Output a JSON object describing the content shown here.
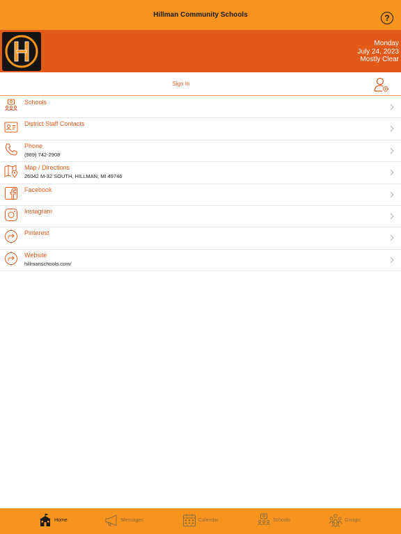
{
  "header": {
    "title": "Hillman Community Schools",
    "help_icon": "help-icon"
  },
  "banner": {
    "day": "Monday",
    "date": "July 24, 2023",
    "weather": "Mostly Clear",
    "logo_letter": "H"
  },
  "signin": {
    "label": "Sign In",
    "icon": "user-settings-icon"
  },
  "list": [
    {
      "label": "Schools",
      "sub": "",
      "icon": "schools-icon"
    },
    {
      "label": "District Staff Contacts",
      "sub": "",
      "icon": "contact-card-icon"
    },
    {
      "label": "Phone",
      "sub": "(989) 742-2908",
      "icon": "phone-icon"
    },
    {
      "label": "Map / Directions",
      "sub": "26042 M-32 SOUTH, HILLMAN, MI 49746",
      "icon": "map-icon"
    },
    {
      "label": "Facebook",
      "sub": "",
      "icon": "facebook-icon"
    },
    {
      "label": "Instagram",
      "sub": "",
      "icon": "instagram-icon"
    },
    {
      "label": "Pinterest",
      "sub": "",
      "icon": "share-icon"
    },
    {
      "label": "Website",
      "sub": "hillmanschools.com/",
      "icon": "share-icon"
    }
  ],
  "tabs": [
    {
      "label": "Home",
      "icon": "school-house-icon",
      "active": true
    },
    {
      "label": "Messages",
      "icon": "megaphone-icon",
      "active": false
    },
    {
      "label": "Calendar",
      "icon": "calendar-icon",
      "active": false
    },
    {
      "label": "Schools",
      "icon": "schools-icon",
      "active": false
    },
    {
      "label": "Groups",
      "icon": "groups-icon",
      "active": false
    }
  ],
  "colors": {
    "accent": "#f7941d",
    "banner": "#e15a1a",
    "link": "#e15a1a"
  }
}
